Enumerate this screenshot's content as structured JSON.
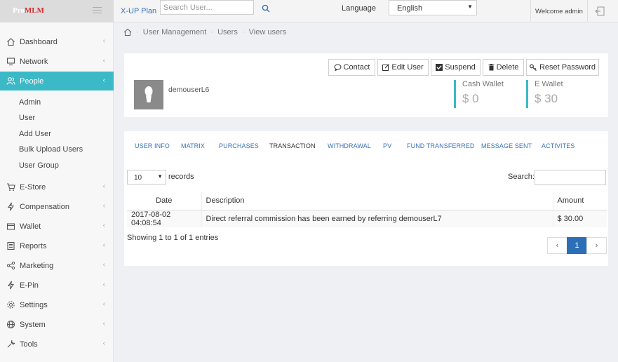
{
  "brand": {
    "logo_prefix": "Pro",
    "logo_suffix": "MLM"
  },
  "topbar": {
    "plan_link": "X-UP Plan",
    "search_placeholder": "Search User...",
    "language_label": "Language",
    "language_value": "English",
    "welcome_text": "Welcome admin"
  },
  "sidebar": {
    "items": [
      {
        "label": "Dashboard",
        "icon": "home-icon"
      },
      {
        "label": "Network",
        "icon": "network-icon"
      },
      {
        "label": "People",
        "icon": "people-icon",
        "active": true
      },
      {
        "label": "E-Store",
        "icon": "cart-icon"
      },
      {
        "label": "Compensation",
        "icon": "bolt-icon"
      },
      {
        "label": "Wallet",
        "icon": "wallet-icon"
      },
      {
        "label": "Reports",
        "icon": "report-icon"
      },
      {
        "label": "Marketing",
        "icon": "share-icon"
      },
      {
        "label": "E-Pin",
        "icon": "bolt-icon"
      },
      {
        "label": "Settings",
        "icon": "gear-icon"
      },
      {
        "label": "System",
        "icon": "globe-icon"
      },
      {
        "label": "Tools",
        "icon": "wrench-icon"
      }
    ],
    "sub_items": [
      "Admin",
      "User",
      "Add User",
      "Bulk Upload Users",
      "User Group"
    ]
  },
  "breadcrumb": {
    "level1": "User Management",
    "level2": "Users",
    "level3": "View users"
  },
  "profile": {
    "username": "demouserL6",
    "actions": {
      "contact": "Contact",
      "edit": "Edit User",
      "suspend": "Suspend",
      "delete": "Delete",
      "reset": "Reset Password"
    },
    "cash_wallet": {
      "label": "Cash Wallet",
      "value": "$ 0"
    },
    "e_wallet": {
      "label": "E Wallet",
      "value": "$ 30"
    }
  },
  "tabs": [
    "USER INFO",
    "MATRIX",
    "PURCHASES",
    "TRANSACTION",
    "WITHDRAWAL",
    "PV",
    "FUND TRANSFERRED",
    "MESSAGE SENT",
    "ACTIVITES"
  ],
  "active_tab": "TRANSACTION",
  "table_controls": {
    "page_length": "10",
    "records_label": "records",
    "search_label": "Search:"
  },
  "table": {
    "headers": {
      "date": "Date",
      "description": "Description",
      "amount": "Amount"
    },
    "rows": [
      {
        "date": "2017-08-02 04:08:54",
        "description": "Direct referral commission has been earned by referring demouserL7",
        "amount": "$ 30.00"
      }
    ]
  },
  "footer": {
    "showing": "Showing 1 to 1 of 1 entries",
    "prev": "‹",
    "page": "1",
    "next": "›"
  },
  "colors": {
    "accent": "#3bb9c6",
    "link": "#3a73b5",
    "pager_active": "#2d6fb6",
    "logo_red": "#d62e2e"
  }
}
